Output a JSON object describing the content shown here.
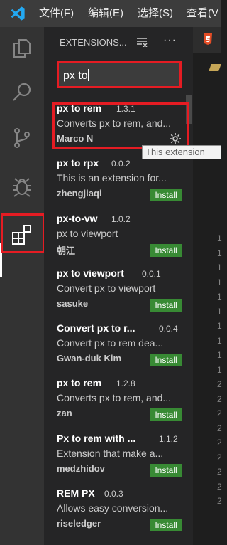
{
  "menubar": {
    "items": [
      "文件(F)",
      "编辑(E)",
      "选择(S)",
      "查看(V"
    ]
  },
  "sidebar": {
    "title": "EXTENSIONS...",
    "search": {
      "value": "px to"
    },
    "extensions": [
      {
        "name": "px to rem",
        "version": "1.3.1",
        "description": "Converts px to rem, and...",
        "publisher": "Marco N",
        "installed": true
      },
      {
        "name": "px to rpx",
        "version": "0.0.2",
        "description": "This is an extension for...",
        "publisher": "zhengjiaqi",
        "action": "Install"
      },
      {
        "name": "px-to-vw",
        "version": "1.0.2",
        "description": "px to viewport",
        "publisher": "朝江",
        "action": "Install"
      },
      {
        "name": "px to viewport",
        "version": "0.0.1",
        "description": "Convert px to viewport",
        "publisher": "sasuke",
        "action": "Install"
      },
      {
        "name": "Convert px to r...",
        "version": "0.0.4",
        "description": "Convert px to rem dea...",
        "publisher": "Gwan-duk Kim",
        "action": "Install"
      },
      {
        "name": "px to rem",
        "version": "1.2.8",
        "description": "Converts px to rem, and...",
        "publisher": "zan",
        "action": "Install"
      },
      {
        "name": "Px to rem with ...",
        "version": "1.1.2",
        "description": "Extension that make a...",
        "publisher": "medzhidov",
        "action": "Install"
      },
      {
        "name": "REM PX",
        "version": "0.0.3",
        "description": "Allows easy conversion...",
        "publisher": "riseledger",
        "action": "Install"
      }
    ]
  },
  "tooltip": {
    "text": "This extension"
  },
  "editor": {
    "line_numbers": [
      "1",
      "1",
      "1",
      "1",
      "1",
      "1",
      "1",
      "1",
      "1",
      "1",
      "2",
      "2",
      "2",
      "2",
      "2",
      "2",
      "2",
      "2",
      "2"
    ]
  },
  "colors": {
    "highlight_red": "#e51c23",
    "install_green": "#388a34",
    "vscode_blue": "#23a9f2",
    "html5_orange": "#e44d26"
  }
}
